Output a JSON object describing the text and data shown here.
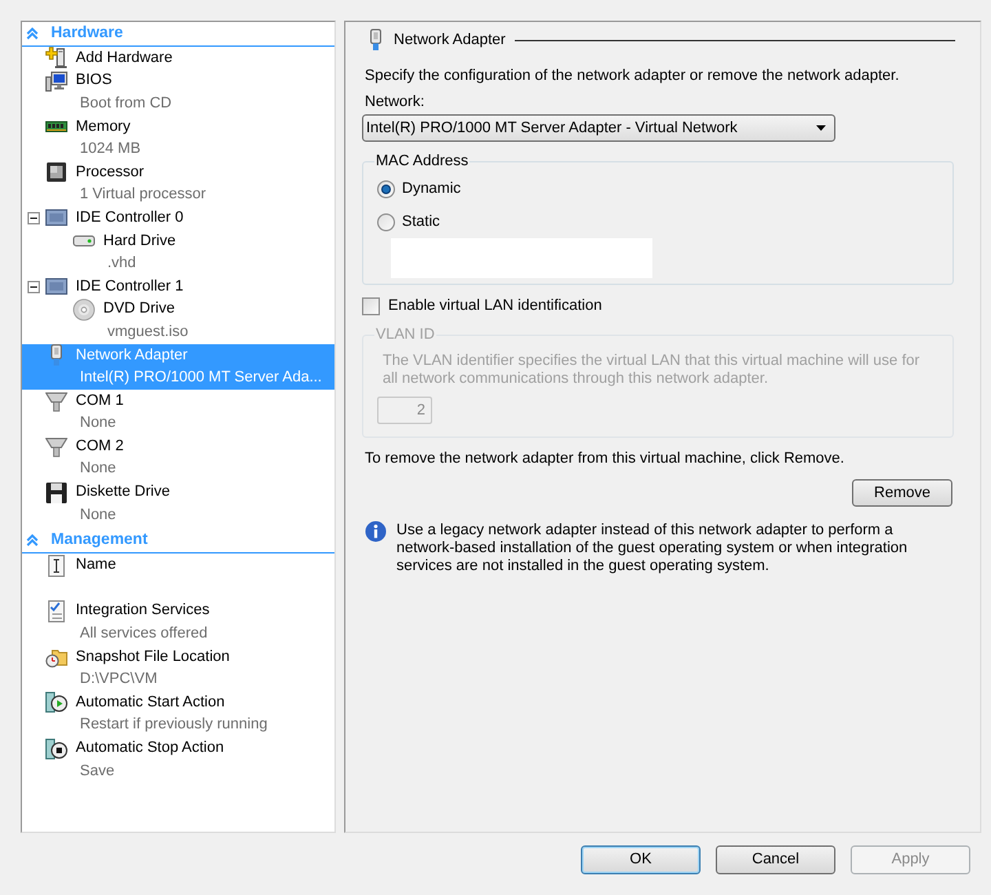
{
  "sidebar": {
    "sections": [
      {
        "title": "Hardware",
        "expanded": true,
        "items": [
          {
            "kind": "add",
            "label": "Add Hardware",
            "selected": false
          },
          {
            "kind": "bios",
            "label": "BIOS",
            "detail": "Boot from CD",
            "selected": false
          },
          {
            "kind": "memory",
            "label": "Memory",
            "detail": "1024 MB",
            "selected": false
          },
          {
            "kind": "processor",
            "label": "Processor",
            "detail": "1 Virtual processor",
            "selected": false
          },
          {
            "kind": "ide",
            "label": "IDE Controller 0",
            "expanded": true,
            "selected": false,
            "children": [
              {
                "kind": "disk",
                "label": "Hard Drive",
                "detail": ".vhd",
                "selected": false
              }
            ]
          },
          {
            "kind": "ide",
            "label": "IDE Controller 1",
            "expanded": true,
            "selected": false,
            "children": [
              {
                "kind": "dvd",
                "label": "DVD Drive",
                "detail": "vmguest.iso",
                "selected": false
              }
            ]
          },
          {
            "kind": "network",
            "label": "Network Adapter",
            "detail": "Intel(R) PRO/1000 MT Server Ada...",
            "selected": true
          },
          {
            "kind": "com",
            "label": "COM 1",
            "detail": "None",
            "selected": false
          },
          {
            "kind": "com",
            "label": "COM 2",
            "detail": "None",
            "selected": false
          },
          {
            "kind": "floppy",
            "label": "Diskette Drive",
            "detail": "None",
            "selected": false
          }
        ]
      },
      {
        "title": "Management",
        "expanded": true,
        "items": [
          {
            "kind": "name",
            "label": "Name",
            "selected": false
          },
          {
            "kind": "integration",
            "label": "Integration Services",
            "detail": "All services offered",
            "selected": false
          },
          {
            "kind": "snapshot",
            "label": "Snapshot File Location",
            "detail": "D:\\VPC\\VM",
            "selected": false
          },
          {
            "kind": "start",
            "label": "Automatic Start Action",
            "detail": "Restart if previously running",
            "selected": false
          },
          {
            "kind": "stop",
            "label": "Automatic Stop Action",
            "detail": "Save",
            "selected": false
          }
        ]
      }
    ]
  },
  "settings": {
    "kind": "network",
    "title": "Network Adapter",
    "description": "Specify the configuration of the network adapter or remove the network adapter.",
    "network": {
      "label": "Network:",
      "value": "Intel(R) PRO/1000 MT Server Adapter - Virtual Network"
    },
    "mac_address": {
      "title": "MAC Address",
      "options": [
        {
          "label": "Dynamic",
          "selected": true
        },
        {
          "label": "Static",
          "selected": false
        }
      ]
    },
    "vlan": {
      "label": "Enable virtual LAN identification",
      "checked": false,
      "title": "VLAN ID",
      "disabled": true,
      "description": "The VLAN identifier specifies the virtual LAN that this virtual machine will use for all network communications through this network adapter.",
      "value": "2"
    },
    "remove": {
      "text": "To remove the network adapter from this virtual machine, click Remove.",
      "button": "Remove"
    },
    "info": "Use a legacy network adapter instead of this network adapter to perform a network-based installation of the guest operating system or when integration services are not installed in the guest operating system."
  },
  "buttons": [
    {
      "label": "OK",
      "focused": true,
      "disabled": false
    },
    {
      "label": "Cancel",
      "focused": false,
      "disabled": false
    },
    {
      "label": "Apply",
      "focused": false,
      "disabled": true
    }
  ]
}
